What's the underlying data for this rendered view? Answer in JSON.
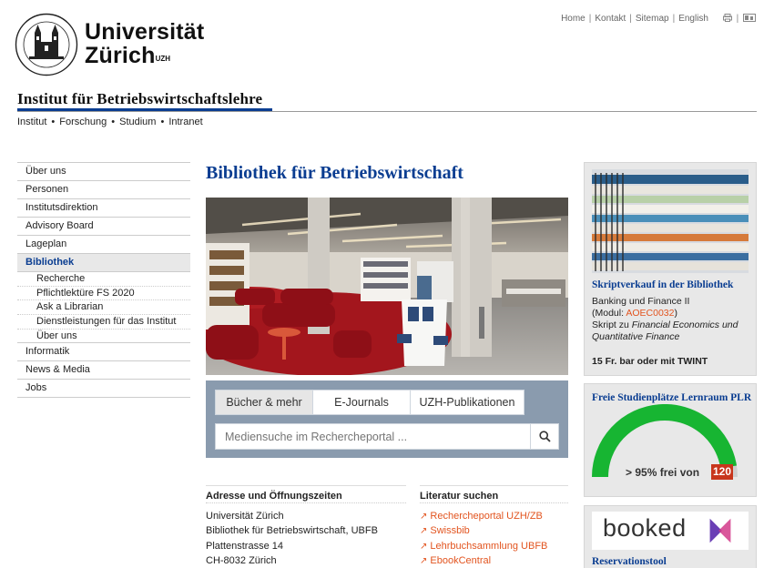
{
  "header": {
    "logo_name": "Universität",
    "logo_name2": "Zürich",
    "logo_uzh": "UZH",
    "top_links": [
      "Home",
      "Kontakt",
      "Sitemap",
      "English"
    ],
    "institute_title": "Institut für Betriebswirtschaftslehre",
    "sub_nav": [
      "Institut",
      "Forschung",
      "Studium",
      "Intranet"
    ]
  },
  "sidebar": {
    "items": [
      {
        "label": "Über uns"
      },
      {
        "label": "Personen"
      },
      {
        "label": "Institutsdirektion"
      },
      {
        "label": "Advisory Board"
      },
      {
        "label": "Lageplan"
      },
      {
        "label": "Bibliothek"
      }
    ],
    "subitems": [
      {
        "label": "Recherche"
      },
      {
        "label": "Pflichtlektüre FS 2020"
      },
      {
        "label": "Ask a Librarian"
      },
      {
        "label": "Dienstleistungen für das Institut"
      },
      {
        "label": "Über uns"
      }
    ],
    "items_after": [
      {
        "label": "Informatik"
      },
      {
        "label": "News & Media"
      },
      {
        "label": "Jobs"
      }
    ]
  },
  "main": {
    "title": "Bibliothek für Betriebswirtschaft",
    "search": {
      "tabs": [
        "Bücher & mehr",
        "E-Journals",
        "UZH-Publikationen"
      ],
      "placeholder": "Mediensuche im Rechercheportal ..."
    },
    "address": {
      "heading": "Adresse und Öffnungszeiten",
      "lines": [
        "Universität Zürich",
        "Bibliothek für Betriebswirtschaft, UBFB",
        "Plattenstrasse 14",
        "CH-8032 Zürich"
      ]
    },
    "literature": {
      "heading": "Literatur suchen",
      "links": [
        "Rechercheportal UZH/ZB",
        "Swissbib",
        "Lehrbuchsammlung UBFB",
        "EbookCentral"
      ]
    }
  },
  "right": {
    "script_box": {
      "title": "Skriptverkauf in der Bibliothek",
      "course": "Banking und Finance II",
      "modul_prefix": "(Modul: ",
      "modul_code": "AOEC0032",
      "modul_suffix": ")",
      "script_prefix": "Skript zu ",
      "script_title": "Financial Economics und Quantitative Finance",
      "price": "15 Fr. bar oder mit TWINT"
    },
    "lernraum_box": {
      "title": "Freie Studienplätze Lernraum PLR",
      "gauge_text": "> 95% frei von",
      "capacity": "120",
      "free_fraction": 0.95
    },
    "booked_box": {
      "logo_text": "booked",
      "title": "Reservationstool"
    }
  },
  "colors": {
    "uzh_blue": "#0a3d91",
    "link_orange": "#e2541f",
    "gauge_green": "#17b532",
    "capacity_red": "#c8361c"
  }
}
